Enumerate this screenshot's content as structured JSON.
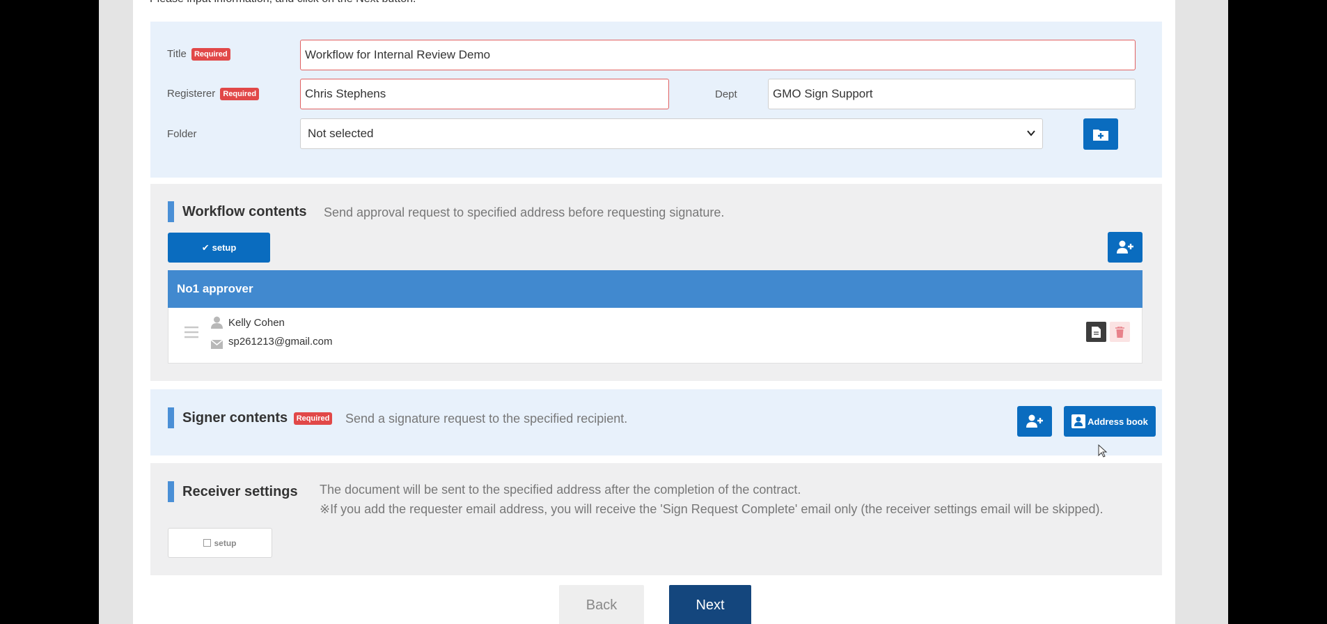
{
  "intro": "Please input information, and click on the Next button.",
  "required_badge": "Required",
  "form": {
    "title_label": "Title",
    "title_value": "Workflow for Internal Review Demo",
    "registerer_label": "Registerer",
    "registerer_value": "Chris Stephens",
    "dept_label": "Dept",
    "dept_value": "GMO Sign Support",
    "folder_label": "Folder",
    "folder_value": "Not selected"
  },
  "workflow": {
    "title": "Workflow contents",
    "description": "Send approval request to specified address before requesting signature.",
    "setup_label": "setup",
    "approver_heading": "No1 approver",
    "approver_name": "Kelly Cohen",
    "approver_email": "sp261213@gmail.com"
  },
  "signer": {
    "title": "Signer contents",
    "description": "Send a signature request to the specified recipient.",
    "address_book_label": "Address book"
  },
  "receiver": {
    "title": "Receiver settings",
    "description_1": "The document will be sent to the specified address after the completion of the contract.",
    "description_2": "※If you add the requester email address, you will receive the 'Sign Request Complete' email only (the receiver settings email will be skipped).",
    "setup_label": "setup"
  },
  "nav": {
    "back_label": "Back",
    "next_label": "Next"
  },
  "colors": {
    "primary": "#0a6cbf",
    "approver_header": "#4189cf",
    "required": "#e14848",
    "next_button": "#14467d"
  }
}
